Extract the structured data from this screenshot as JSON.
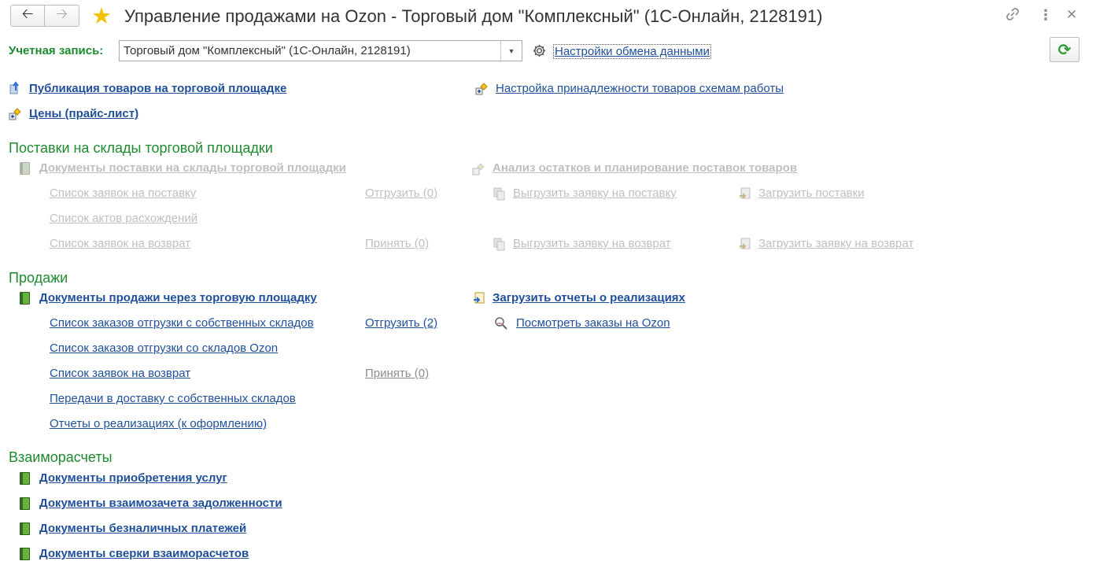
{
  "window": {
    "title": "Управление продажами на Ozon - Торговый дом \"Комплексный\" (1С-Онлайн, 2128191)"
  },
  "account": {
    "label": "Учетная запись:",
    "value": "Торговый дом \"Комплексный\" (1С-Онлайн, 2128191)",
    "settings_link": "Настройки обмена данными"
  },
  "top_links": {
    "publish": "Публикация товаров на торговой площадке",
    "prices": "Цены (прайс-лист)",
    "schemes": "Настройка принадлежности товаров схемам работы"
  },
  "supplies": {
    "heading": "Поставки на склады торговой площадки",
    "docs": "Документы поставки на склады торговой площадки",
    "analysis": "Анализ остатков и планирование поставок товаров",
    "requests": "Список заявок на поставку",
    "ship": "Отгрузить (0)",
    "export_request": "Выгрузить заявку на поставку",
    "import_supplies": "Загрузить поставки",
    "discrepancy": "Список актов расхождений",
    "returns": "Список заявок на возврат",
    "accept": "Принять (0)",
    "export_return": "Выгрузить заявку на возврат",
    "import_return": "Загрузить заявку на возврат"
  },
  "sales": {
    "heading": "Продажи",
    "docs": "Документы продажи через торговую площадку",
    "import_reports": "Загрузить отчеты о реализациях",
    "orders_own": "Список заказов отгрузки с собственных складов",
    "ship": "Отгрузить (2)",
    "view_orders": "Посмотреть заказы на Ozon",
    "orders_ozon": "Список заказов отгрузки со складов Ozon",
    "returns": "Список заявок на возврат",
    "accept": "Принять (0)",
    "transfers": "Передачи в доставку с собственных складов",
    "reports": "Отчеты о реализациях (к оформлению)"
  },
  "settlements": {
    "heading": "Взаиморасчеты",
    "services": "Документы приобретения услуг",
    "offset": "Документы взаимозачета задолженности",
    "payments": "Документы безналичных платежей",
    "reconciliation": "Документы сверки взаиморасчетов"
  },
  "colors": {
    "link": "#1f4f9a",
    "disabled": "#bfbfbf",
    "section": "#1d8a2f"
  }
}
